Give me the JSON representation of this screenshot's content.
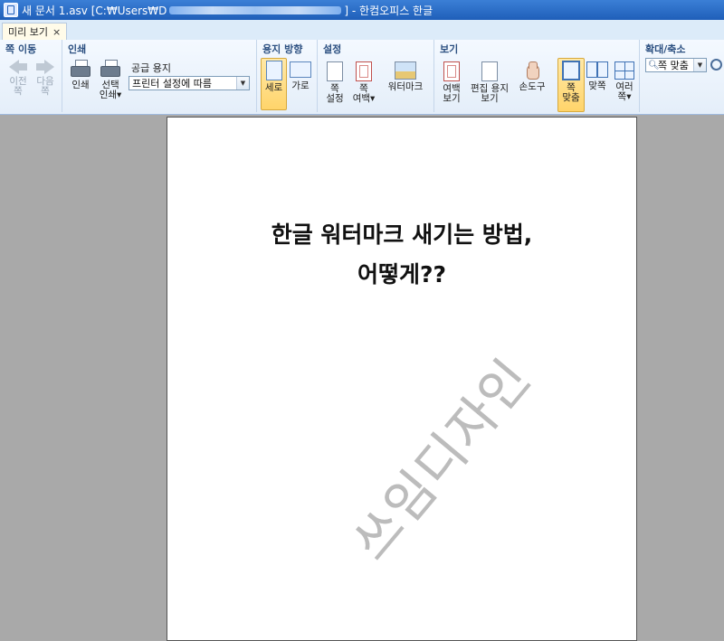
{
  "titlebar": {
    "doc_prefix": "새 문서 1.asv [C:₩Users₩D",
    "doc_suffix": "] - 한컴오피스 한글"
  },
  "tab": {
    "label": "미리 보기",
    "close": "×"
  },
  "groups": {
    "page_move": {
      "title": "쪽 이동",
      "prev": [
        "이전",
        "쪽"
      ],
      "next": [
        "다음",
        "쪽"
      ]
    },
    "print": {
      "title": "인쇄",
      "print": "인쇄",
      "select_print": [
        "선택",
        "인쇄▾"
      ],
      "paper_label": "공급 용지",
      "paper_value": "프린터 설정에 따름"
    },
    "orientation": {
      "title": "용지 방향",
      "portrait": "세로",
      "landscape": "가로"
    },
    "settings": {
      "title": "설정",
      "page_setup": [
        "쪽",
        "설정"
      ],
      "margin": [
        "쪽",
        "여백▾"
      ],
      "watermark": "워터마크"
    },
    "view": {
      "title": "보기",
      "margin_view": [
        "여백",
        "보기"
      ],
      "edit_paper": [
        "편집 용지",
        "보기"
      ],
      "hand_tool": "손도구",
      "fit_page": [
        "쪽",
        "맞춤"
      ],
      "facing": "맞쪽",
      "multi": [
        "여러",
        "쪽▾"
      ]
    },
    "zoom": {
      "title": "확대/축소",
      "zoom_value": "쪽 맞춤"
    }
  },
  "document": {
    "title_line1": "한글 워터마크 새기는 방법,",
    "title_line2": "어떻게??",
    "watermark_text": "쓰임디자인"
  },
  "colors": {
    "titlebar": "#1f5fb9",
    "ribbon": "#e4eef9",
    "workspace": "#a9a9a9",
    "watermark": "#bcbcbc"
  }
}
